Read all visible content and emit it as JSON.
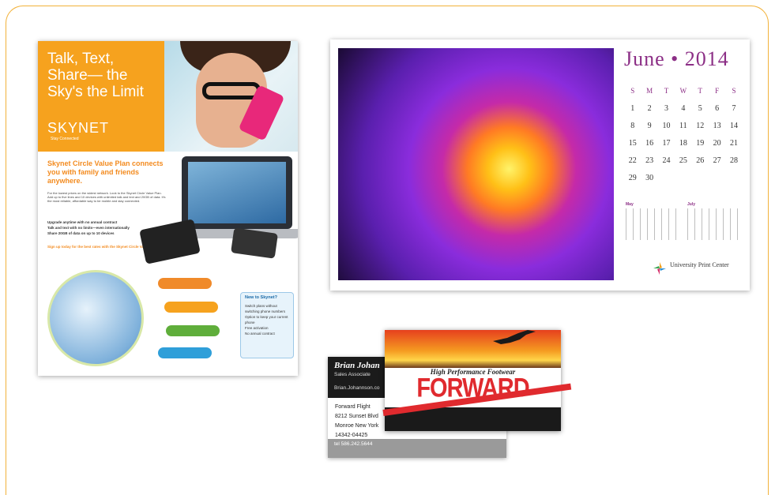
{
  "colors": {
    "frame": "#f2b23a",
    "flyer_orange": "#f6a21e",
    "calendar_purple": "#8c2f86",
    "brand_red": "#e02a2e"
  },
  "flyer": {
    "headline": "Talk, Text, Share— the Sky's the Limit",
    "logo": "SKYNET",
    "logo_tagline": "Stay Connected",
    "subhead": "Skynet Circle Value Plan connects you with family and friends anywhere.",
    "body": "For the lowest prices on the widest network. Look to the Skynet Circle Value Plan. Add up to five lines and 10 devices with unlimited talk and text and 20GB of data. It's the most reliable, affordable way to be mobile and stay connected.",
    "bullets": [
      "Upgrade anytime with no annual contract",
      "Talk and text with no limits—even internationally",
      "Share 20GB of data on up to 10 devices"
    ],
    "cta": "Sign up today for the best rates with the Skynet Circle Value Plan.",
    "new_box": {
      "title": "New to Skynet?",
      "items": [
        "Switch plans without switching phone numbers",
        "Option to keep your current phone",
        "Free activation",
        "No annual contract"
      ]
    }
  },
  "calendar": {
    "title": "June • 2014",
    "days_of_week": [
      "S",
      "M",
      "T",
      "W",
      "T",
      "F",
      "S"
    ],
    "weeks": [
      [
        "1",
        "2",
        "3",
        "4",
        "5",
        "6",
        "7"
      ],
      [
        "8",
        "9",
        "10",
        "11",
        "12",
        "13",
        "14"
      ],
      [
        "15",
        "16",
        "17",
        "18",
        "19",
        "20",
        "21"
      ],
      [
        "22",
        "23",
        "24",
        "25",
        "26",
        "27",
        "28"
      ],
      [
        "29",
        "30",
        "",
        "",
        "",
        "",
        ""
      ]
    ],
    "mini_months": [
      "May",
      "July"
    ],
    "logo_text": "University Print Center"
  },
  "card_back": {
    "name": "Brian Johan",
    "role": "Sales Associate",
    "email": "Brian.Johannson.co",
    "address_lines": [
      "Forward Flight",
      "8212 Sunset Blvd",
      "Monroe New York",
      "14342-04425"
    ],
    "tel": "tel 586.242.5644"
  },
  "card_front": {
    "tagline": "High Performance Footwear",
    "brand": "FORWARD FLIGHT"
  }
}
